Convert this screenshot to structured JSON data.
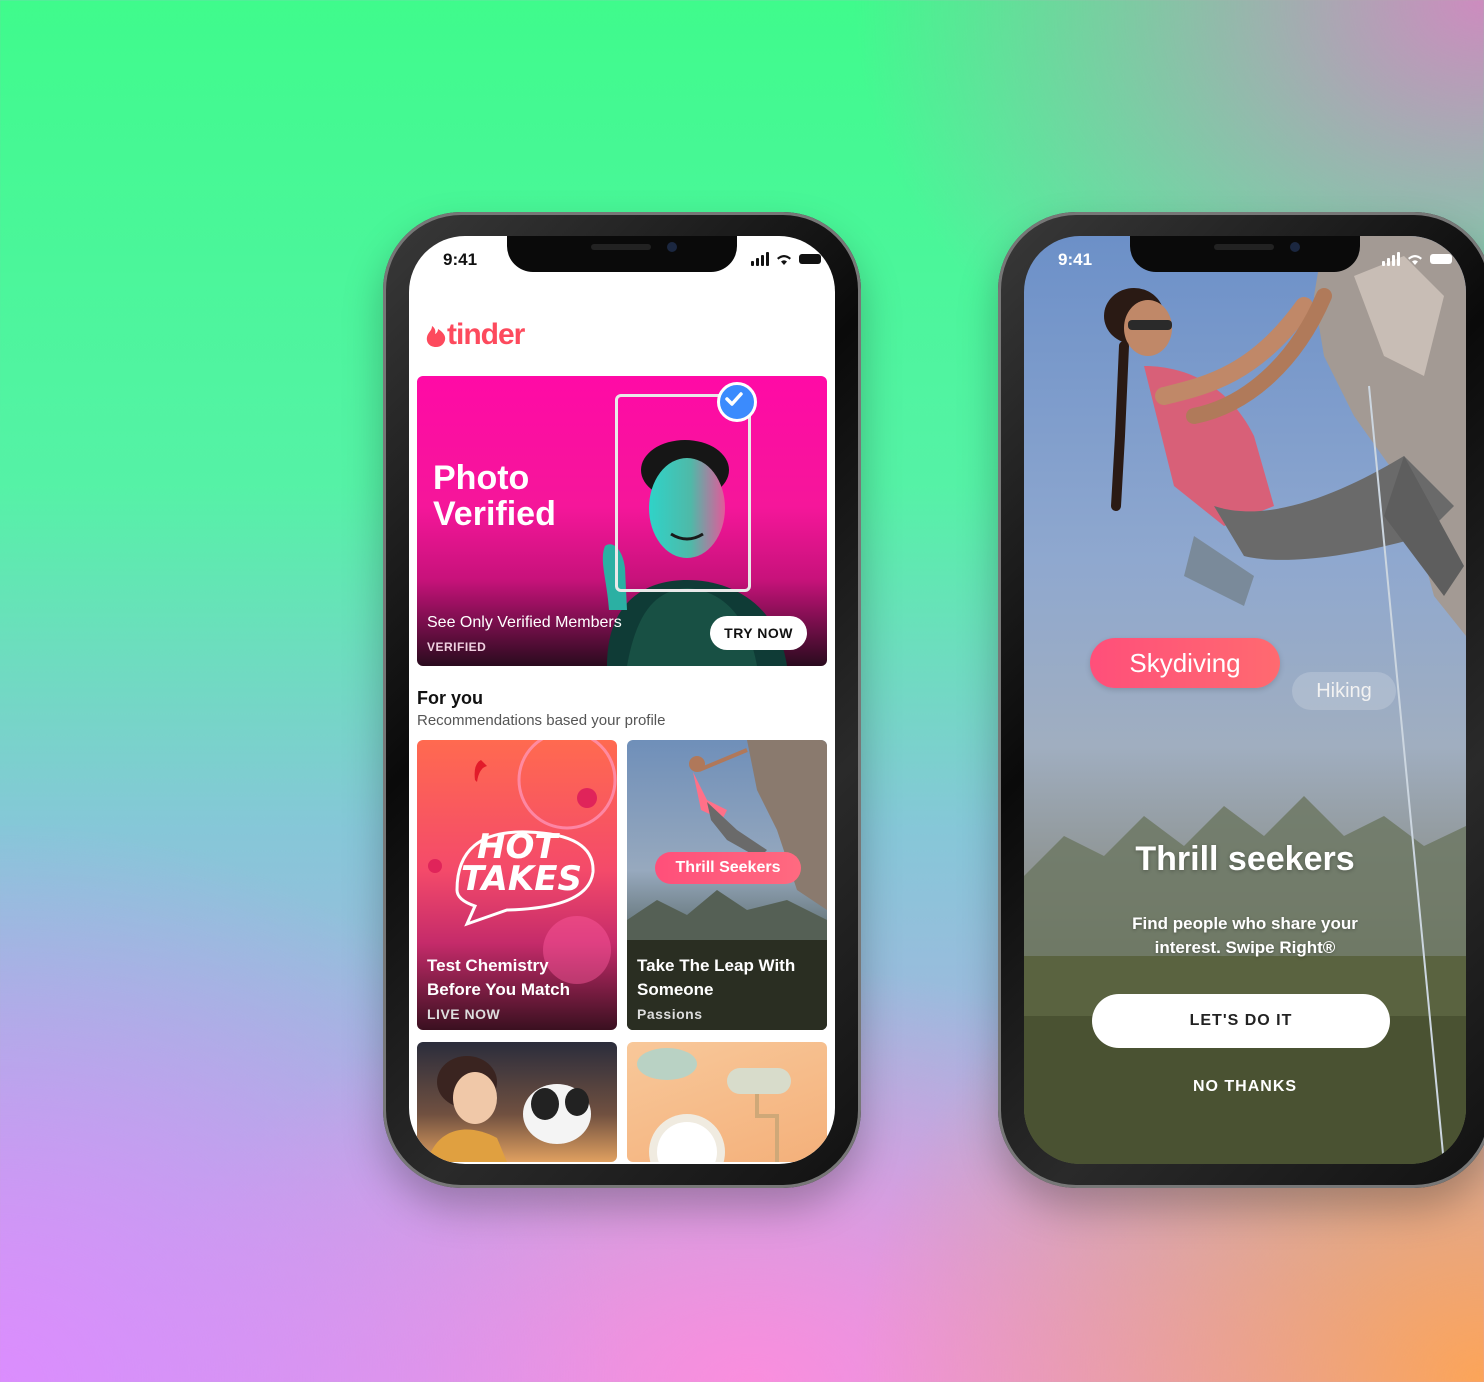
{
  "phone_left": {
    "status": {
      "time": "9:41"
    },
    "brand": {
      "logo_text": "tinder",
      "color": "#fd4a5d"
    },
    "hero": {
      "title_line1": "Photo",
      "title_line2": "Verified",
      "subtitle": "See Only Verified Members",
      "tag": "VERIFIED",
      "button": "TRY NOW"
    },
    "for_you": {
      "heading": "For you",
      "subheading": "Recommendations based your profile"
    },
    "cards": [
      {
        "art_line1": "HOT",
        "art_line2": "TAKES",
        "title_line1": "Test Chemistry",
        "title_line2": "Before You Match",
        "tag": "LIVE NOW"
      },
      {
        "pill": "Thrill Seekers",
        "title_line1": "Take The Leap With",
        "title_line2": "Someone",
        "tag": "Passions"
      }
    ]
  },
  "phone_right": {
    "status": {
      "time": "9:41"
    },
    "interest_active": "Skydiving",
    "interest_secondary": "Hiking",
    "title": "Thrill seekers",
    "subtitle_line1": "Find people who share your",
    "subtitle_line2": "interest. Swipe Right®",
    "primary_button": "LET'S DO IT",
    "secondary_button": "NO THANKS"
  },
  "colors": {
    "accent_pink": "#ff0aa6",
    "tinder_red": "#fd4a5d",
    "verified_blue": "#3b8bfd",
    "pill_gradient_start": "#ff4f7a",
    "pill_gradient_end": "#ff6a50"
  }
}
